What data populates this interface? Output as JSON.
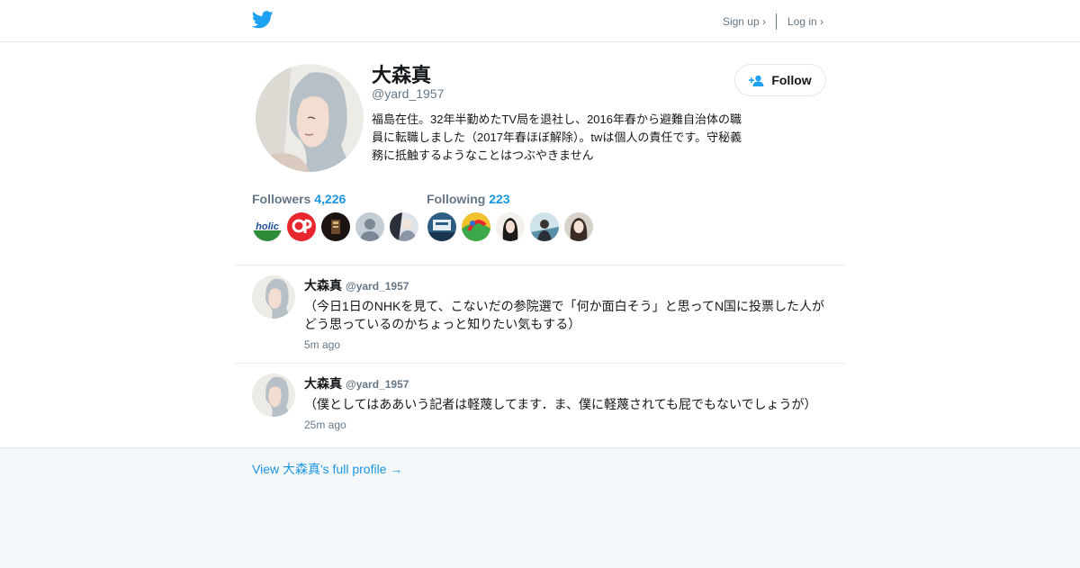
{
  "header": {
    "signup_label": "Sign up ›",
    "login_label": "Log in ›",
    "logo_icon": "twitter-bird-icon",
    "brand_color": "#1da1f2"
  },
  "profile": {
    "name": "大森真",
    "handle": "@yard_1957",
    "bio": "福島在住。32年半勤めたTV局を退社し、2016年春から避難自治体の職員に転職しました（2017年春ほぼ解除）。twは個人の責任です。守秘義務に抵触するようなことはつぶやきません",
    "follow_label": "Follow",
    "followers_label": "Followers",
    "followers_count": "4,226",
    "following_label": "Following",
    "following_count": "223"
  },
  "tweets": [
    {
      "name": "大森真",
      "handle": "@yard_1957",
      "text": "（今日1日のNHKを見て、こないだの参院選で「何か面白そう」と思ってN国に投票した人がどう思っているのかちょっと知りたい気もする）",
      "time": "5m ago"
    },
    {
      "name": "大森真",
      "handle": "@yard_1957",
      "text": "（僕としてはああいう記者は軽蔑してます．ま、僕に軽蔑されても屁でもないでしょうが）",
      "time": "25m ago"
    }
  ],
  "footer": {
    "full_profile_link": "View 大森真's full profile →"
  },
  "colors": {
    "link": "#1b95e0",
    "muted": "#657786",
    "footer_bg": "#f5f8fa"
  }
}
